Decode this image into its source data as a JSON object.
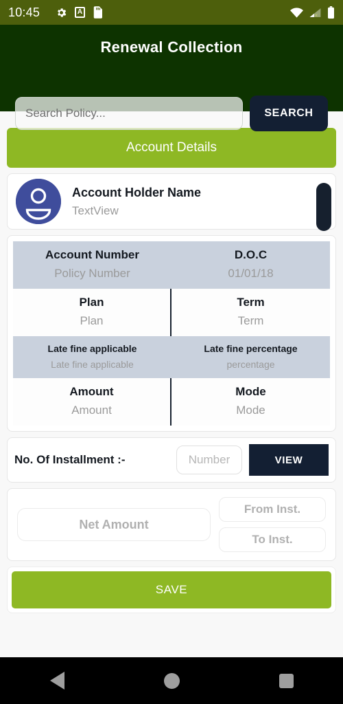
{
  "status_bar": {
    "time": "10:45",
    "icons_left": [
      "gear-icon",
      "a-badge-icon",
      "sd-card-icon"
    ],
    "a_badge_label": "A",
    "icons_right": [
      "wifi-icon",
      "cell-signal-no-sim-icon",
      "battery-icon"
    ],
    "background_color": "#4d5f0c"
  },
  "header": {
    "title": "Renewal Collection",
    "background_color": "#0d3300"
  },
  "search": {
    "placeholder": "Search Policy...",
    "value": "",
    "button_label": "SEARCH",
    "button_color": "#131f33"
  },
  "section": {
    "title": "Account Details",
    "accent_color": "#8eb824"
  },
  "account_holder": {
    "avatar_icon": "person-avatar-icon",
    "avatar_color": "#3f4d9c",
    "name": "Account Holder Name",
    "subtitle": "TextView"
  },
  "details_table": {
    "rows": [
      {
        "style": "gray",
        "size": "normal",
        "left": {
          "label": "Account Number",
          "value": "Policy Number"
        },
        "right": {
          "label": "D.O.C",
          "value": "01/01/18"
        }
      },
      {
        "style": "white",
        "size": "normal",
        "left": {
          "label": "Plan",
          "value": "Plan"
        },
        "right": {
          "label": "Term",
          "value": "Term"
        }
      },
      {
        "style": "gray",
        "size": "small",
        "left": {
          "label": "Late fine applicable",
          "value": "Late fine applicable"
        },
        "right": {
          "label": "Late fine percentage",
          "value": "percentage"
        }
      },
      {
        "style": "white",
        "size": "normal",
        "left": {
          "label": "Amount",
          "value": "Amount"
        },
        "right": {
          "label": "Mode",
          "value": "Mode"
        }
      }
    ]
  },
  "installment": {
    "label": "No. Of Installment :-",
    "number_placeholder": "Number",
    "number_value": "",
    "view_button_label": "VIEW"
  },
  "net_amount": {
    "placeholder": "Net Amount",
    "value": "",
    "from_placeholder": "From Inst.",
    "from_value": "",
    "to_placeholder": "To Inst.",
    "to_value": ""
  },
  "save": {
    "label": "SAVE",
    "color": "#8eb824"
  },
  "nav_bar": {
    "items": [
      "back-icon",
      "home-icon",
      "recents-icon"
    ],
    "background_color": "#000000"
  }
}
